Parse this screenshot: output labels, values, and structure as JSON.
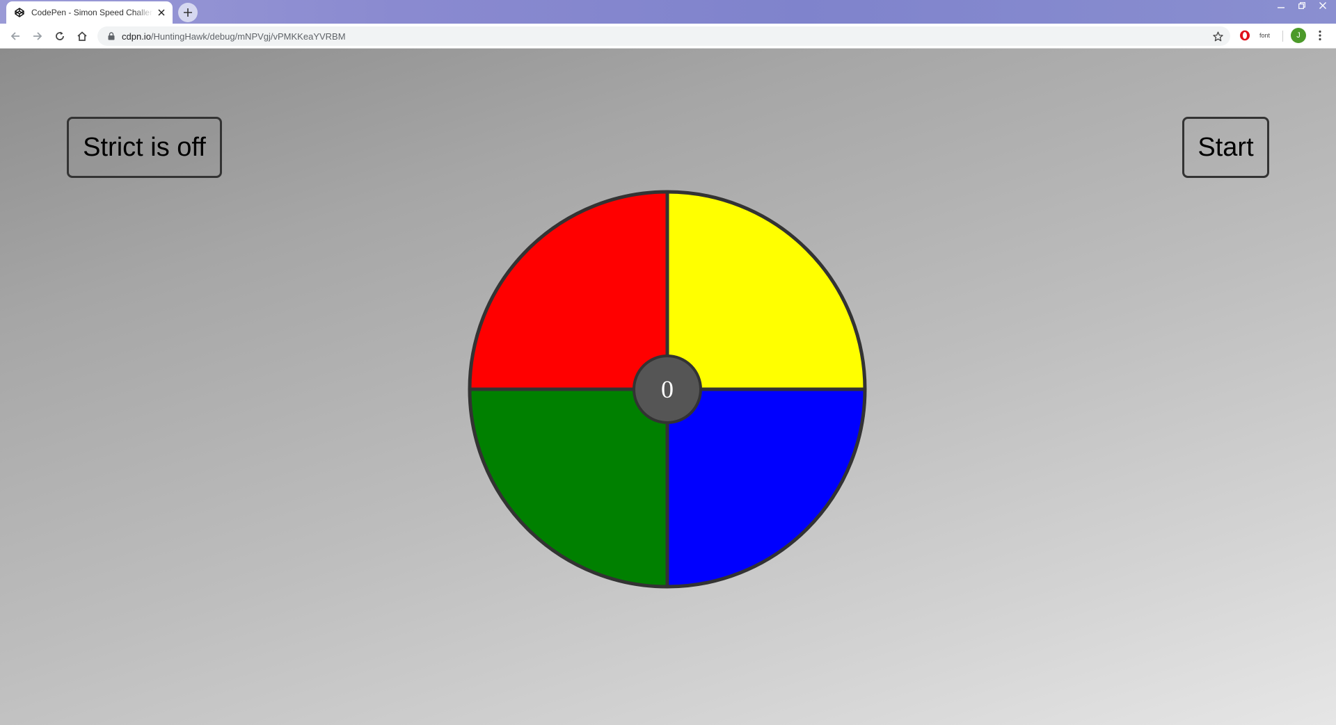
{
  "browser": {
    "tab": {
      "title": "CodePen - Simon Speed Challenge",
      "favicon": "codepen-icon"
    },
    "address_bar": {
      "host": "cdpn.io",
      "path": "/HuntingHawk/debug/mNPVgj/vPMKKeaYVRBM"
    },
    "extensions": {
      "font_label": "font"
    },
    "profile_initial": "J"
  },
  "game": {
    "strict_label": "Strict is off",
    "start_label": "Start",
    "score": "0",
    "colors": {
      "top_left": "#ff0000",
      "top_right": "#ffff00",
      "bottom_left": "#008000",
      "bottom_right": "#0000ff",
      "border": "#333333",
      "center": "#555555"
    }
  }
}
